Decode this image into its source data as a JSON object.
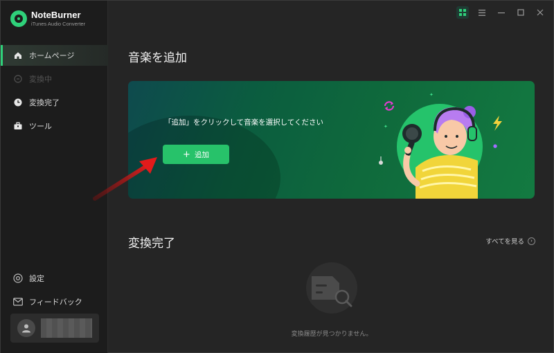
{
  "brand": {
    "name": "NoteBurner",
    "subtitle": "iTunes Audio Converter"
  },
  "sidebar": {
    "items": [
      {
        "label": "ホームページ",
        "icon": "home-icon",
        "state": "active"
      },
      {
        "label": "変換中",
        "icon": "converting-icon",
        "state": "disabled"
      },
      {
        "label": "変換完了",
        "icon": "clock-icon",
        "state": "normal"
      },
      {
        "label": "ツール",
        "icon": "toolbox-icon",
        "state": "normal"
      }
    ],
    "bottom_items": [
      {
        "label": "設定",
        "icon": "settings-icon"
      },
      {
        "label": "フィードバック",
        "icon": "mail-icon"
      }
    ]
  },
  "main": {
    "add_section_title": "音楽を追加",
    "banner_instruction": "「追加」をクリックして音楽を選択してください",
    "add_button_label": "追加",
    "converted_section_title": "変換完了",
    "view_all_label": "すべてを見る",
    "empty_message": "変換履歴が見つかりません。"
  },
  "colors": {
    "accent": "#2fd17a",
    "button": "#27c26a",
    "background": "#252525",
    "sidebar": "#1c1c1c"
  }
}
